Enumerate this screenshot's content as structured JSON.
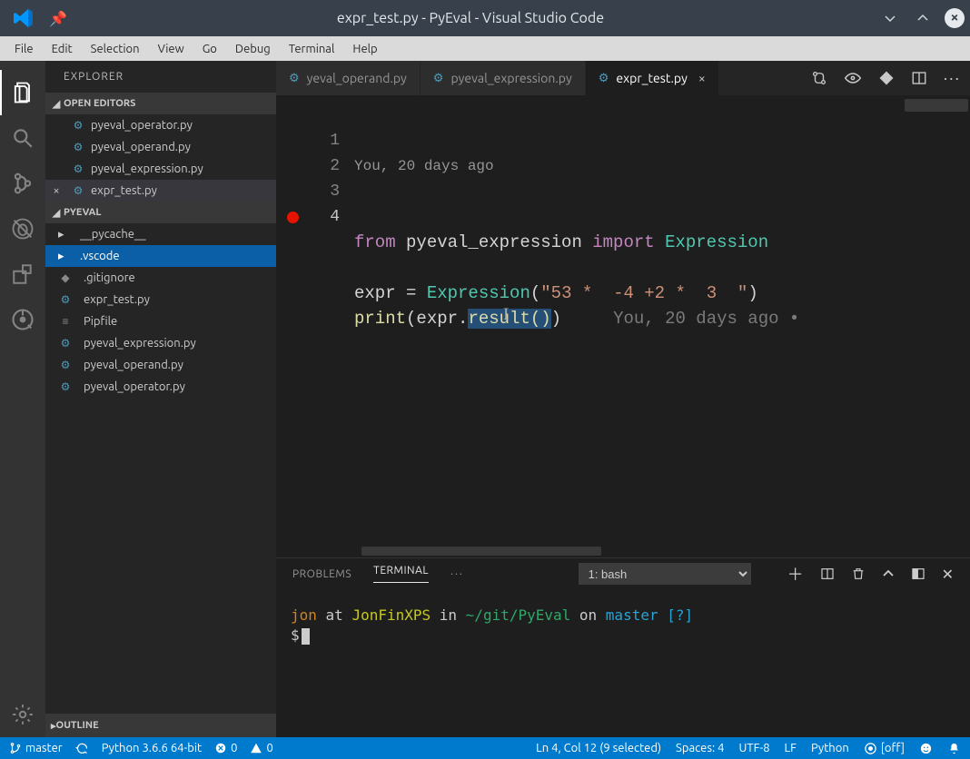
{
  "titlebar": {
    "title": "expr_test.py - PyEval - Visual Studio Code"
  },
  "menus": [
    "File",
    "Edit",
    "Selection",
    "View",
    "Go",
    "Debug",
    "Terminal",
    "Help"
  ],
  "sidebar": {
    "title": "EXPLORER",
    "openEditorsLabel": "OPEN EDITORS",
    "openEditors": [
      {
        "name": "pyeval_operator.py",
        "active": false
      },
      {
        "name": "pyeval_operand.py",
        "active": false
      },
      {
        "name": "pyeval_expression.py",
        "active": false
      },
      {
        "name": "expr_test.py",
        "active": true
      }
    ],
    "projectLabel": "PYEVAL",
    "tree": [
      {
        "kind": "folder",
        "name": "__pycache__"
      },
      {
        "kind": "folder",
        "name": ".vscode",
        "selected": true
      },
      {
        "kind": "file",
        "name": ".gitignore",
        "icon": "git"
      },
      {
        "kind": "file",
        "name": "expr_test.py",
        "icon": "py"
      },
      {
        "kind": "file",
        "name": "Pipfile",
        "icon": "txt"
      },
      {
        "kind": "file",
        "name": "pyeval_expression.py",
        "icon": "py"
      },
      {
        "kind": "file",
        "name": "pyeval_operand.py",
        "icon": "py"
      },
      {
        "kind": "file",
        "name": "pyeval_operator.py",
        "icon": "py"
      }
    ],
    "outlineLabel": "OUTLINE"
  },
  "tabs": [
    {
      "label": "yeval_operand.py",
      "active": false,
      "close": false
    },
    {
      "label": "pyeval_expression.py",
      "active": false,
      "close": false
    },
    {
      "label": "expr_test.py",
      "active": true,
      "close": true
    }
  ],
  "editor": {
    "lens": "You, 20 days ago",
    "lines": [
      {
        "n": 1,
        "segments": [
          {
            "t": "from ",
            "c": "kw"
          },
          {
            "t": "pyeval_expression ",
            "c": "var"
          },
          {
            "t": "import ",
            "c": "kw"
          },
          {
            "t": "Expression",
            "c": "id"
          }
        ]
      },
      {
        "n": 2,
        "segments": []
      },
      {
        "n": 3,
        "segments": [
          {
            "t": "expr ",
            "c": "var"
          },
          {
            "t": "= ",
            "c": "var"
          },
          {
            "t": "Expression",
            "c": "id"
          },
          {
            "t": "(",
            "c": "var"
          },
          {
            "t": "\"53 *  -4 +2 *  3  \"",
            "c": "str"
          },
          {
            "t": ")",
            "c": "var"
          }
        ]
      },
      {
        "n": 4,
        "segments": [
          {
            "t": "print",
            "c": "fn"
          },
          {
            "t": "(",
            "c": "var"
          },
          {
            "t": "expr",
            "c": "var"
          },
          {
            "t": ".",
            "c": "var"
          },
          {
            "t": "result()",
            "c": "fn",
            "sel": true
          },
          {
            "t": ")",
            "c": "var"
          },
          {
            "t": "     ",
            "c": "var"
          },
          {
            "t": "You, 20 days ago •",
            "c": "after"
          }
        ]
      }
    ],
    "currentLine": 4
  },
  "panel": {
    "tabs": {
      "problems": "PROBLEMS",
      "terminal": "TERMINAL"
    },
    "terminalSelect": "1: bash",
    "terminal": {
      "user": "jon",
      "at": " at ",
      "host": "JonFinXPS",
      "in": " in ",
      "path": "~/git/PyEval",
      "on": " on ",
      "branch": "master",
      "flag": " [?]",
      "prompt": "$"
    }
  },
  "statusbar": {
    "branch": "master",
    "python": "Python 3.6.6 64-bit",
    "errors": "0",
    "warnings": "0",
    "lncol": "Ln 4, Col 12 (9 selected)",
    "spaces": "Spaces: 4",
    "encoding": "UTF-8",
    "eol": "LF",
    "lang": "Python",
    "live": "[off]"
  }
}
